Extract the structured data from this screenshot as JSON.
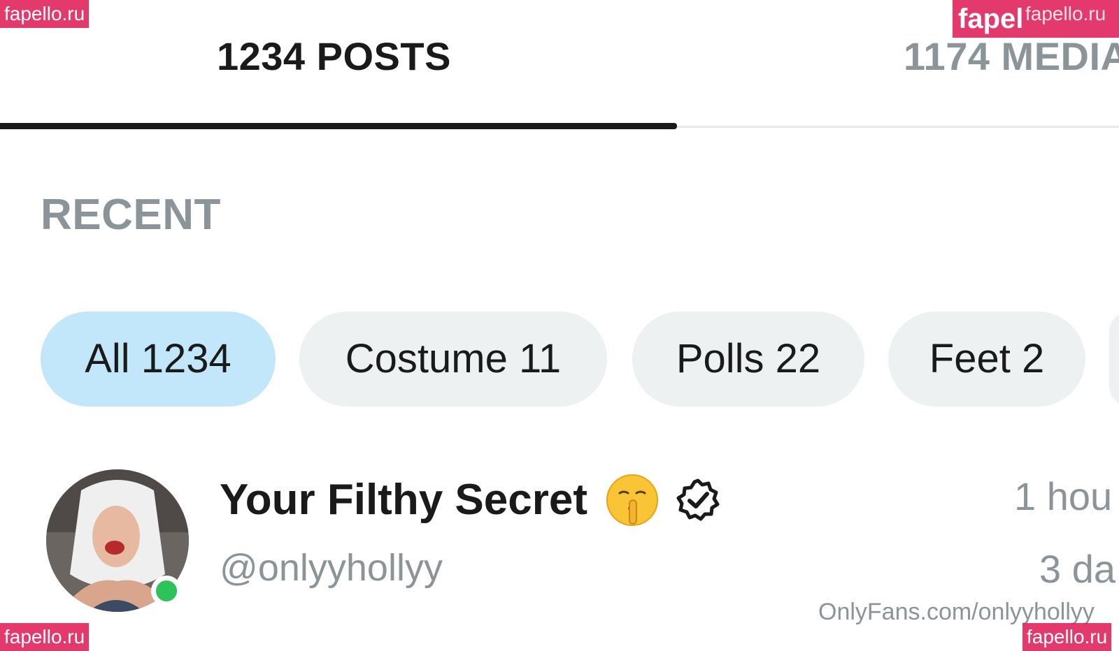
{
  "tabs": {
    "posts_label": "1234 POSTS",
    "media_label": "1174 MEDIA"
  },
  "section": {
    "heading": "RECENT"
  },
  "filters": [
    {
      "label": "All 1234",
      "active": true
    },
    {
      "label": "Costume 11",
      "active": false
    },
    {
      "label": "Polls 22",
      "active": false
    },
    {
      "label": "Feet 2",
      "active": false
    }
  ],
  "post": {
    "display_name": "Your Filthy Secret",
    "emoji_icon": "shushing-face-icon",
    "verified_icon": "verified-badge-icon",
    "handle": "@onlyyhollyy",
    "time_primary": "1 hou",
    "time_secondary": "3 da",
    "online": true
  },
  "watermarks": {
    "top_left": "fapello.ru",
    "top_right_large": "fapel",
    "top_right_small": "fapello.ru",
    "bottom_left": "fapello.ru",
    "bottom_right": "fapello.ru",
    "source_url": "OnlyFans.com/onlyyhollyy"
  },
  "colors": {
    "active_chip": "#c2e7fa",
    "chip": "#edf1f2",
    "muted_text": "#8a9499",
    "primary_text": "#1a1a1a",
    "online": "#2ec25a",
    "watermark": "#e0245e"
  }
}
